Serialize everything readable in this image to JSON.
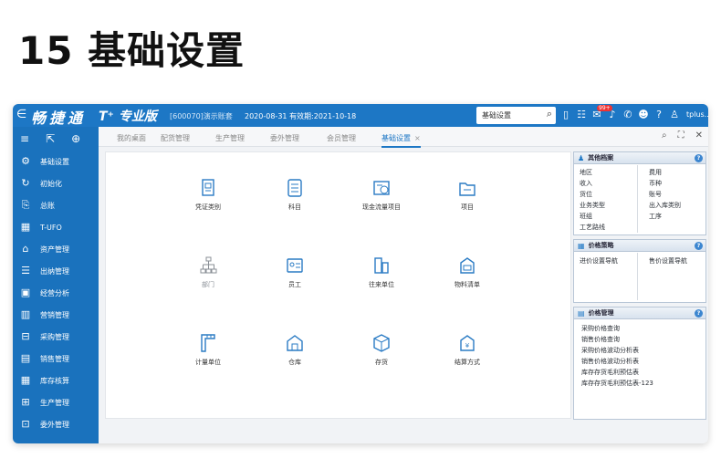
{
  "heading": "15 基础设置",
  "topbar": {
    "menu_glyph": "∈",
    "logo": "畅捷通",
    "product": "T⁺ 专业版",
    "account": "[600070]演示账套",
    "dates": "2020-08-31  有效期:2021-10-18",
    "search_value": "基础设置",
    "badge": "99+",
    "user": "tplus..."
  },
  "sidebar": {
    "items": [
      {
        "label": "基础设置",
        "icon": "gear-icon",
        "glyph": "⚙"
      },
      {
        "label": "初始化",
        "icon": "refresh-icon",
        "glyph": "↻"
      },
      {
        "label": "总账",
        "icon": "ledger-icon",
        "glyph": "⎘"
      },
      {
        "label": "T-UFO",
        "icon": "ufo-icon",
        "glyph": "▦"
      },
      {
        "label": "资产管理",
        "icon": "bank-icon",
        "glyph": "⌂"
      },
      {
        "label": "出纳管理",
        "icon": "cashier-icon",
        "glyph": "☰"
      },
      {
        "label": "经营分析",
        "icon": "monitor-icon",
        "glyph": "▣"
      },
      {
        "label": "营销管理",
        "icon": "chart-icon",
        "glyph": "▥"
      },
      {
        "label": "采购管理",
        "icon": "cart-icon",
        "glyph": "⊟"
      },
      {
        "label": "销售管理",
        "icon": "bars-icon",
        "glyph": "▤"
      },
      {
        "label": "库存核算",
        "icon": "stock-icon",
        "glyph": "▦"
      },
      {
        "label": "生产管理",
        "icon": "production-icon",
        "glyph": "⊞"
      },
      {
        "label": "委外管理",
        "icon": "outsource-icon",
        "glyph": "⊡"
      }
    ]
  },
  "tabs": [
    {
      "label": "我的桌面"
    },
    {
      "label": "配货管理"
    },
    {
      "label": "生产管理"
    },
    {
      "label": "委外管理"
    },
    {
      "label": "会员管理"
    },
    {
      "label": "基础设置",
      "active": true
    }
  ],
  "tab_close": "×",
  "functions": [
    {
      "label": "凭证类别",
      "icon": "voucher-icon"
    },
    {
      "label": "科目",
      "icon": "subject-icon"
    },
    {
      "label": "现金流量项目",
      "icon": "cashflow-icon"
    },
    {
      "label": "项目",
      "icon": "project-icon"
    },
    {
      "label": "部门",
      "icon": "department-icon",
      "gray": true
    },
    {
      "label": "员工",
      "icon": "employee-icon"
    },
    {
      "label": "往来单位",
      "icon": "partner-icon"
    },
    {
      "label": "物料清单",
      "icon": "bom-icon"
    },
    {
      "label": "计量单位",
      "icon": "unit-icon"
    },
    {
      "label": "仓库",
      "icon": "warehouse-icon"
    },
    {
      "label": "存货",
      "icon": "inventory-icon"
    },
    {
      "label": "结算方式",
      "icon": "settlement-icon"
    }
  ],
  "panels": {
    "other": {
      "title": "其他档案",
      "help": "?",
      "left": [
        "地区",
        "收入",
        "货位",
        "业务类型",
        "班组",
        "工艺路线"
      ],
      "right": [
        "费用",
        "币种",
        "账号",
        "出入库类别",
        "工序"
      ]
    },
    "price_policy": {
      "title": "价格策略",
      "help": "?",
      "left": [
        "进价设置导航"
      ],
      "right": [
        "售价设置导航"
      ]
    },
    "price_manage": {
      "title": "价格管理",
      "help": "?",
      "items": [
        "采购价格查询",
        "销售价格查询",
        "采购价格波动分析表",
        "销售价格波动分析表",
        "库存存货毛利预估表",
        "库存存货毛利预估表-123"
      ]
    }
  },
  "colors": {
    "brand": "#1d77c5",
    "sidebar": "#1a72bd",
    "badge": "#e33333"
  }
}
